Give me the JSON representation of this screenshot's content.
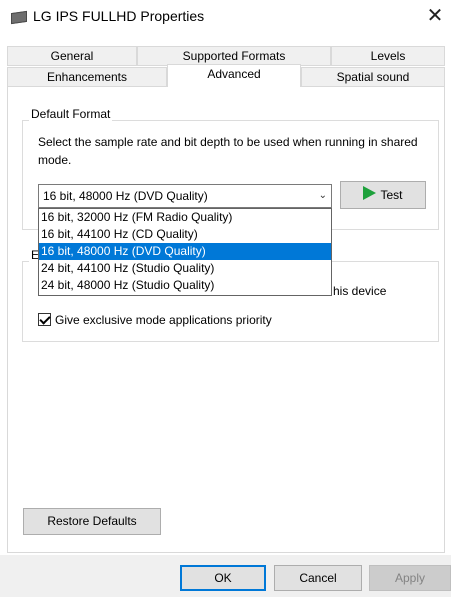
{
  "window": {
    "title": "LG IPS FULLHD Properties",
    "close_label": "✕"
  },
  "tabs": {
    "row1": [
      {
        "label": "General"
      },
      {
        "label": "Supported Formats"
      },
      {
        "label": "Levels"
      }
    ],
    "row2": [
      {
        "label": "Enhancements"
      },
      {
        "label": "Advanced",
        "active": true
      },
      {
        "label": "Spatial sound"
      }
    ]
  },
  "default_format": {
    "legend": "Default Format",
    "description": "Select the sample rate and bit depth to be used when running in shared mode.",
    "selected_value": "16 bit, 48000 Hz (DVD Quality)",
    "options": [
      "16 bit, 32000 Hz (FM Radio Quality)",
      "16 bit, 44100 Hz (CD Quality)",
      "16 bit, 48000 Hz (DVD Quality)",
      "24 bit, 44100 Hz (Studio Quality)",
      "24 bit, 48000 Hz (Studio Quality)"
    ],
    "selected_index": 2,
    "test_label": "Test"
  },
  "exclusive_mode": {
    "legend_visible": "E",
    "allow_label_visible_tail": "his device",
    "allow_checked": true,
    "priority_label": "Give exclusive mode applications priority",
    "priority_checked": true
  },
  "restore_defaults_label": "Restore Defaults",
  "footer": {
    "ok_label": "OK",
    "cancel_label": "Cancel",
    "apply_label": "Apply"
  },
  "colors": {
    "selection": "#0078d7",
    "test_icon": "#1ea13c",
    "ok_border": "#0078d7"
  }
}
